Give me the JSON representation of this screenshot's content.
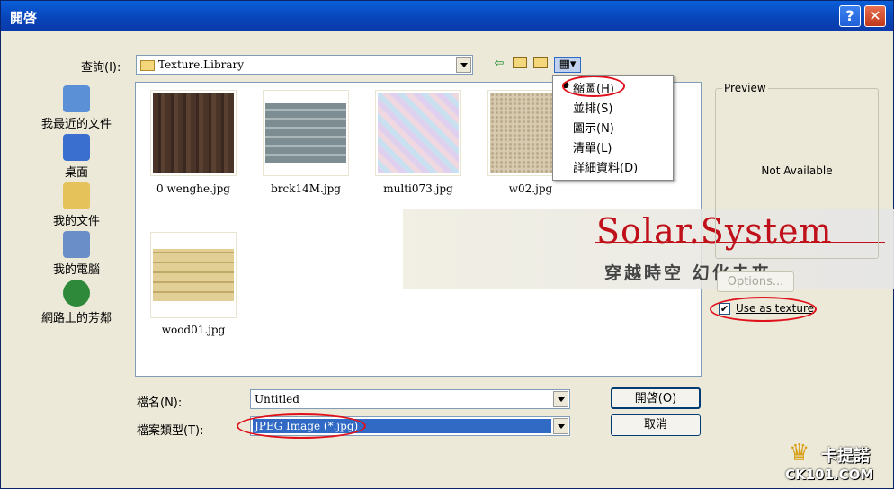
{
  "window": {
    "title": "開啓",
    "help_glyph": "?",
    "close_glyph": "✕"
  },
  "lookin": {
    "label": "查詢(I):",
    "value": "Texture.Library"
  },
  "toolbar": {
    "back_icon": "back-arrow-icon",
    "up_icon": "up-folder-icon",
    "newfolder_icon": "new-folder-icon",
    "view_icon": "view-menu-icon"
  },
  "places": [
    {
      "label": "我最近的文件",
      "icon": "recent-documents-icon",
      "color": "#5b8fd6"
    },
    {
      "label": "桌面",
      "icon": "desktop-icon",
      "color": "#3a6fd0"
    },
    {
      "label": "我的文件",
      "icon": "my-documents-icon",
      "color": "#e6c25a"
    },
    {
      "label": "我的電腦",
      "icon": "my-computer-icon",
      "color": "#6a8fc8"
    },
    {
      "label": "網路上的芳鄰",
      "icon": "network-icon",
      "color": "#2e8a3a"
    }
  ],
  "files": [
    {
      "name": "0 wenghe.jpg",
      "color": "#4a3428"
    },
    {
      "name": "brck14M.jpg",
      "color": "#8a9aa0"
    },
    {
      "name": "multi073.jpg",
      "color": "#d8c8e8"
    },
    {
      "name": "w02.jpg",
      "color": "#cfc0a4"
    },
    {
      "name": "wood01.jpg",
      "color": "#e2cf96"
    }
  ],
  "view_menu": [
    {
      "label": "縮圖(H)",
      "selected": true
    },
    {
      "label": "並排(S)"
    },
    {
      "label": "圖示(N)"
    },
    {
      "label": "清單(L)"
    },
    {
      "label": "詳細資料(D)"
    }
  ],
  "filename": {
    "label": "檔名(N):",
    "value": "Untitled"
  },
  "filetype": {
    "label": "檔案類型(T):",
    "value": "JPEG Image (*.jpg)"
  },
  "buttons": {
    "open": "開啓(O)",
    "cancel": "取消",
    "options": "Options..."
  },
  "preview": {
    "label": "Preview",
    "status": "Not Available"
  },
  "use_texture": {
    "label": "Use as texture",
    "checked": true
  },
  "watermark": {
    "title": "Solar.System",
    "subtitle": "穿越時空 幻化未來"
  },
  "badge": {
    "top": "卡提諾",
    "bottom": "CK101.COM"
  },
  "colors": {
    "title_bar": "#0843b8",
    "annotation": "#e0101a",
    "selection": "#316ac5"
  }
}
